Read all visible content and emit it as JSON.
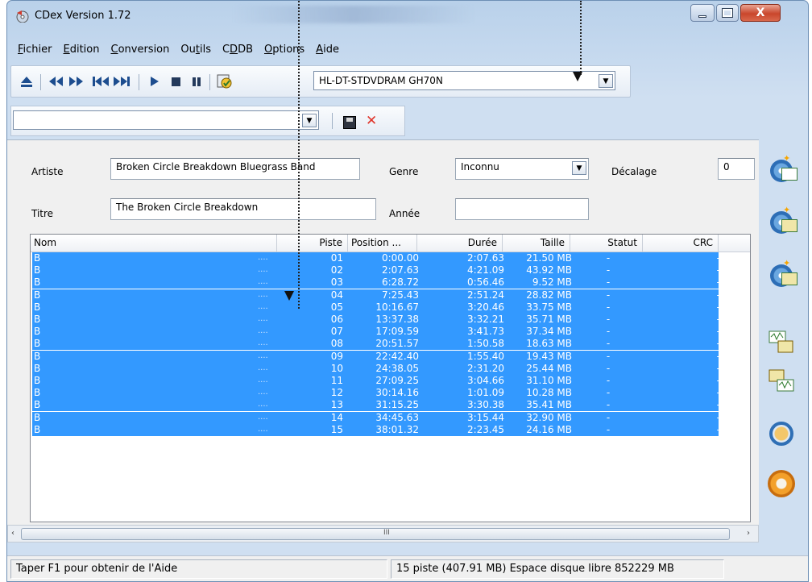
{
  "window": {
    "title": "CDex Version 1.72",
    "minimize_label": "",
    "maximize_label": "",
    "close_label": "X"
  },
  "menu": [
    "Fichier",
    "Edition",
    "Conversion",
    "Outils",
    "CDDB",
    "Options",
    "Aide"
  ],
  "menu_mnemonics": [
    "F",
    "E",
    "C",
    "t",
    "D",
    "O",
    "A"
  ],
  "toolbar": {
    "icons": [
      "eject-icon",
      "rewind-icon",
      "fast-forward-icon",
      "previous-track-icon",
      "next-track-icon",
      "play-icon",
      "stop-icon",
      "pause-icon",
      "cd-info-icon"
    ],
    "drive": "HL-DT-STDVDRAM GH70N"
  },
  "toolbar2": {
    "profile_value": ""
  },
  "fields": {
    "artist_label": "Artiste",
    "artist_value": "Broken Circle Breakdown Bluegrass Band",
    "title_label": "Titre",
    "title_value": "The Broken Circle Breakdown",
    "genre_label": "Genre",
    "genre_value": "Inconnu",
    "year_label": "Année",
    "year_value": "",
    "offset_label": "Décalage",
    "offset_value": "0"
  },
  "table": {
    "headers": [
      "Nom",
      "Piste",
      "Position ...",
      "Durée",
      "Taille",
      "Statut",
      "CRC"
    ],
    "rows": [
      {
        "nom": "B",
        "piste": "01",
        "position": "0:00.00",
        "duree": "2:07.63",
        "taille": "21.50 MB",
        "statut": "-",
        "crc": "-"
      },
      {
        "nom": "B",
        "piste": "02",
        "position": "2:07.63",
        "duree": "4:21.09",
        "taille": "43.92 MB",
        "statut": "-",
        "crc": "-"
      },
      {
        "nom": "B",
        "piste": "03",
        "position": "6:28.72",
        "duree": "0:56.46",
        "taille": "9.52 MB",
        "statut": "-",
        "crc": "-"
      },
      {
        "nom": "B",
        "piste": "04",
        "position": "7:25.43",
        "duree": "2:51.24",
        "taille": "28.82 MB",
        "statut": "-",
        "crc": "-"
      },
      {
        "nom": "B",
        "piste": "05",
        "position": "10:16.67",
        "duree": "3:20.46",
        "taille": "33.75 MB",
        "statut": "-",
        "crc": "-"
      },
      {
        "nom": "B",
        "piste": "06",
        "position": "13:37.38",
        "duree": "3:32.21",
        "taille": "35.71 MB",
        "statut": "-",
        "crc": "-"
      },
      {
        "nom": "B",
        "piste": "07",
        "position": "17:09.59",
        "duree": "3:41.73",
        "taille": "37.34 MB",
        "statut": "-",
        "crc": "-"
      },
      {
        "nom": "B",
        "piste": "08",
        "position": "20:51.57",
        "duree": "1:50.58",
        "taille": "18.63 MB",
        "statut": "-",
        "crc": "-"
      },
      {
        "nom": "B",
        "piste": "09",
        "position": "22:42.40",
        "duree": "1:55.40",
        "taille": "19.43 MB",
        "statut": "-",
        "crc": "-"
      },
      {
        "nom": "B",
        "piste": "10",
        "position": "24:38.05",
        "duree": "2:31.20",
        "taille": "25.44 MB",
        "statut": "-",
        "crc": "-"
      },
      {
        "nom": "B",
        "piste": "11",
        "position": "27:09.25",
        "duree": "3:04.66",
        "taille": "31.10 MB",
        "statut": "-",
        "crc": "-"
      },
      {
        "nom": "B",
        "piste": "12",
        "position": "30:14.16",
        "duree": "1:01.09",
        "taille": "10.28 MB",
        "statut": "-",
        "crc": "-"
      },
      {
        "nom": "B",
        "piste": "13",
        "position": "31:15.25",
        "duree": "3:30.38",
        "taille": "35.41 MB",
        "statut": "-",
        "crc": "-"
      },
      {
        "nom": "B",
        "piste": "14",
        "position": "34:45.63",
        "duree": "3:15.44",
        "taille": "32.90 MB",
        "statut": "-",
        "crc": "-"
      },
      {
        "nom": "B",
        "piste": "15",
        "position": "38:01.32",
        "duree": "2:23.45",
        "taille": "24.16 MB",
        "statut": "-",
        "crc": "-"
      }
    ],
    "selection_color": "#3399ff"
  },
  "scrollbar": {
    "grip": "III",
    "left_arrow": "‹",
    "right_arrow": "›"
  },
  "status": {
    "help": "Taper F1 pour obtenir de l'Aide",
    "summary": "15 piste (407.91 MB) Espace disque libre 852229 MB"
  },
  "side_buttons": [
    "extract-wave-icon",
    "extract-mp3-icon",
    "extract-partial-icon",
    "convert-wave-icon",
    "convert-mp3-wave-icon",
    "play-icon",
    "settings-icon"
  ]
}
